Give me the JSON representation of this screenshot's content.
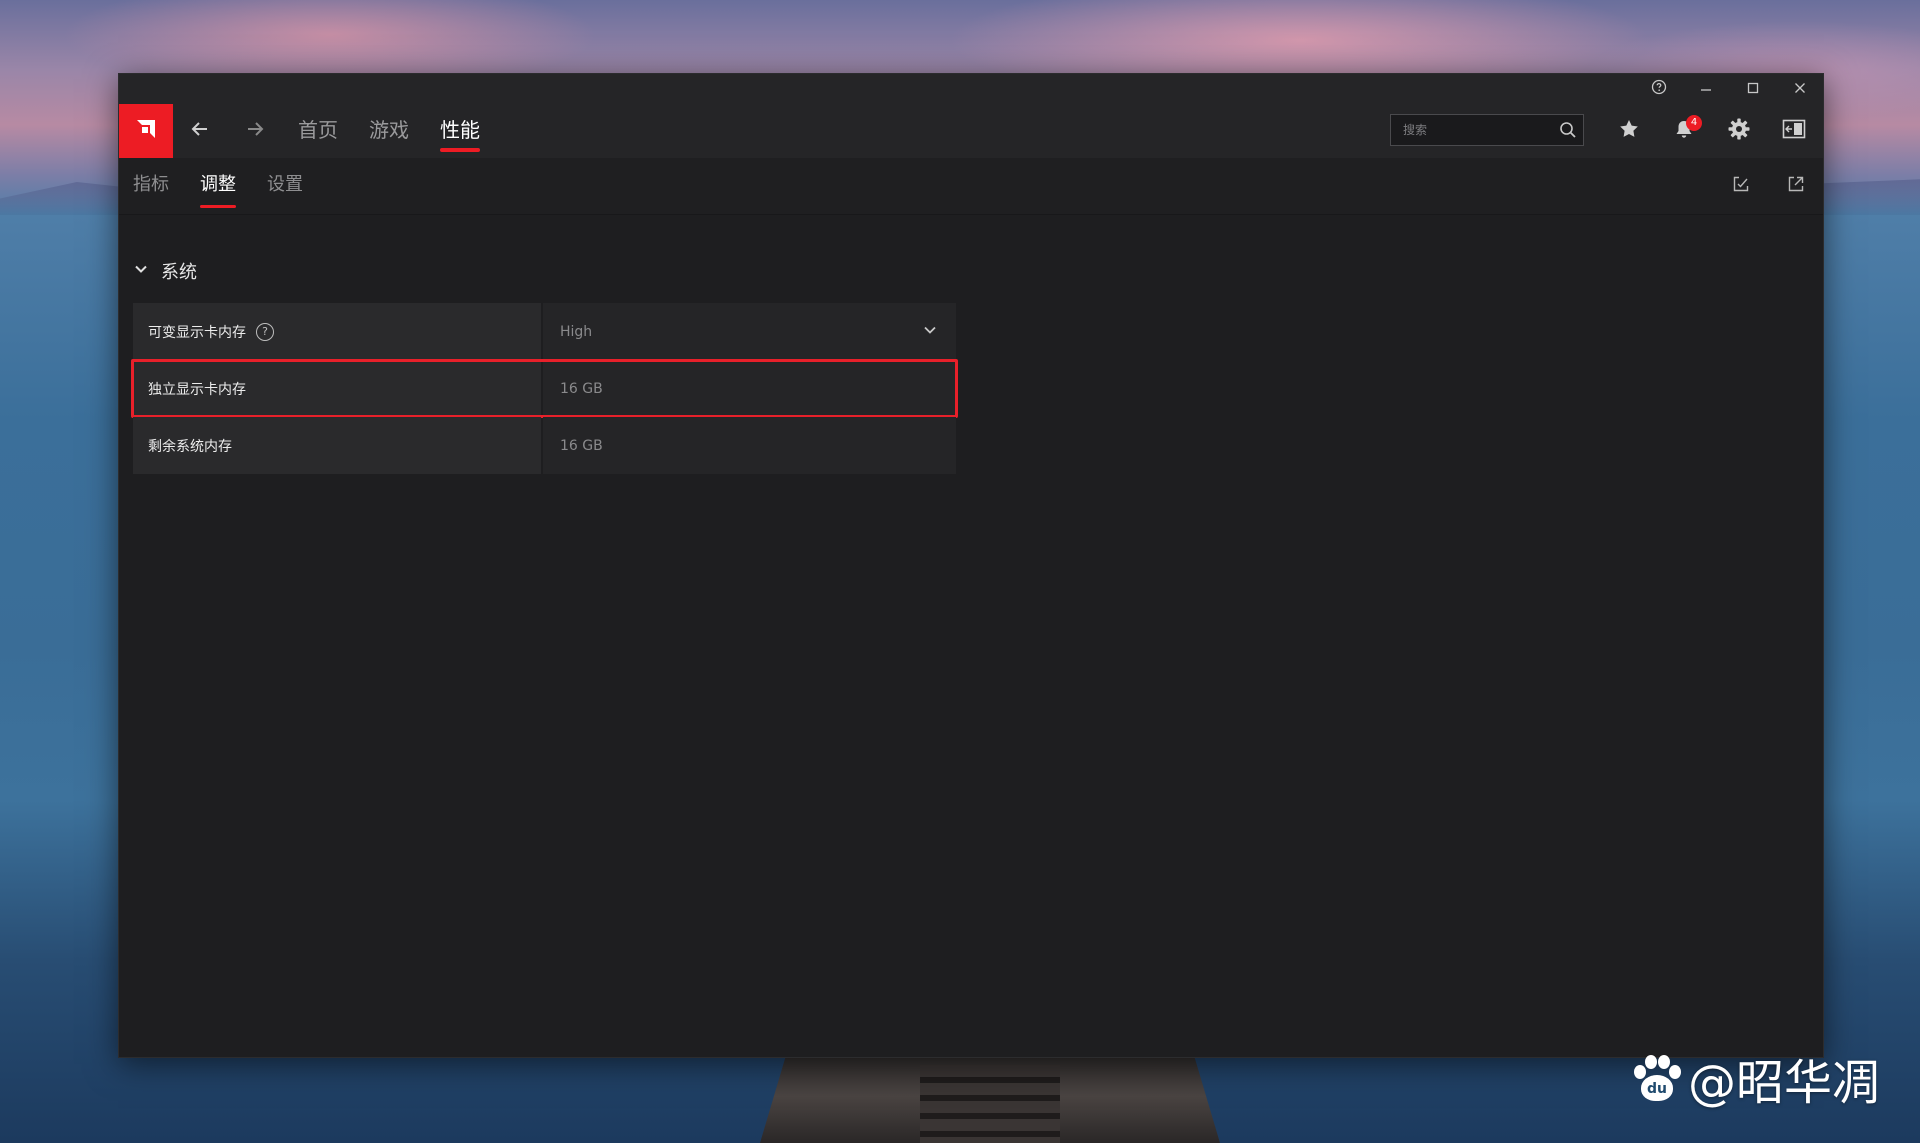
{
  "window": {
    "controls": [
      "help",
      "minimize",
      "maximize",
      "close"
    ]
  },
  "nav": {
    "tabs": [
      {
        "label": "首页",
        "active": false
      },
      {
        "label": "游戏",
        "active": false
      },
      {
        "label": "性能",
        "active": true
      }
    ],
    "search_placeholder": "搜索",
    "notification_count": "4",
    "accent_color": "#ed1c24"
  },
  "subnav": {
    "tabs": [
      {
        "label": "指标",
        "active": false
      },
      {
        "label": "调整",
        "active": true
      },
      {
        "label": "设置",
        "active": false
      }
    ]
  },
  "section": {
    "title": "系统",
    "rows": [
      {
        "label": "可变显示卡内存",
        "value": "High",
        "type": "dropdown",
        "has_help": true
      },
      {
        "label": "独立显示卡内存",
        "value": "16 GB",
        "type": "readonly",
        "highlighted": true
      },
      {
        "label": "剩余系统内存",
        "value": "16 GB",
        "type": "readonly"
      }
    ]
  },
  "watermark": {
    "text": "@昭华凋",
    "logo": "du"
  }
}
